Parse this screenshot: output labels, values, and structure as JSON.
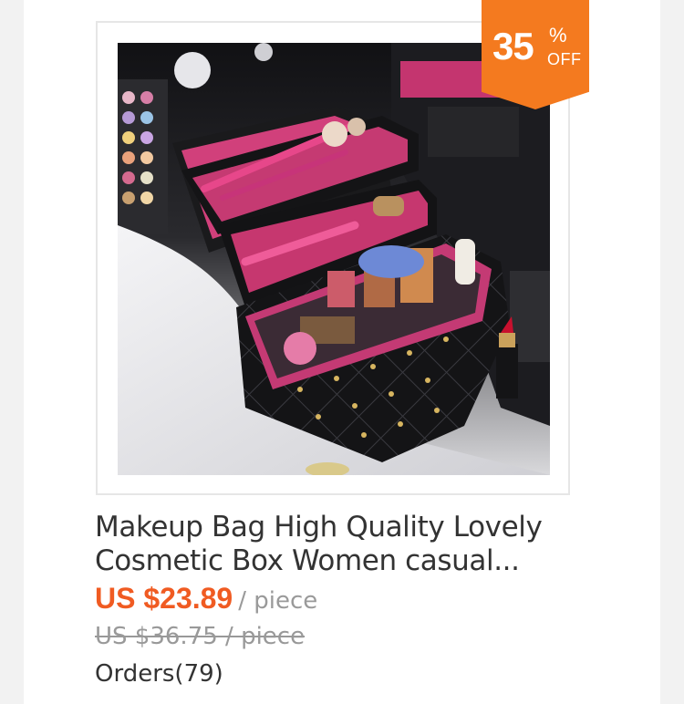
{
  "product": {
    "title": "Makeup Bag High Quality Lovely Cosmetic Box Women casual...",
    "price": "US $23.89",
    "price_unit": "/ piece",
    "original_price": "US $36.75 / piece",
    "orders": "Orders(79)"
  },
  "badge": {
    "number": "35",
    "percent": "%",
    "off": "OFF",
    "color": "#f47a1f"
  },
  "colors": {
    "price": "#f05b22",
    "title": "#333333",
    "muted": "#999999"
  }
}
